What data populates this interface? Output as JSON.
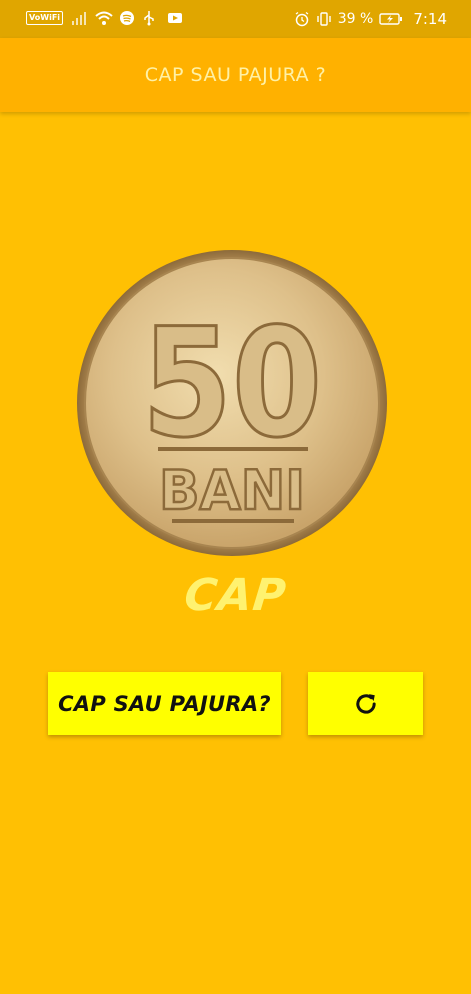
{
  "status_bar": {
    "vowifi": "VoWiFi",
    "battery_percent": "39 %",
    "time": "7:14",
    "icons": [
      "signal-icon",
      "wifi-icon",
      "spotify-icon",
      "usb-icon",
      "youtube-icon",
      "alarm-icon",
      "vibrate-icon",
      "battery-icon"
    ]
  },
  "app_bar": {
    "title": "CAP SAU PAJURA ?"
  },
  "coin": {
    "denomination": "50",
    "currency": "BANI"
  },
  "result": {
    "text": "CAP"
  },
  "buttons": {
    "flip_label": "CAP SAU PAJURA?",
    "reset_icon": "refresh-icon"
  },
  "colors": {
    "background": "#FFC003",
    "app_bar": "#FFB100",
    "status_bar": "#E0A600",
    "button": "#FFFF00",
    "result_text": "#FFF270",
    "title_text": "#FFF1A6"
  }
}
